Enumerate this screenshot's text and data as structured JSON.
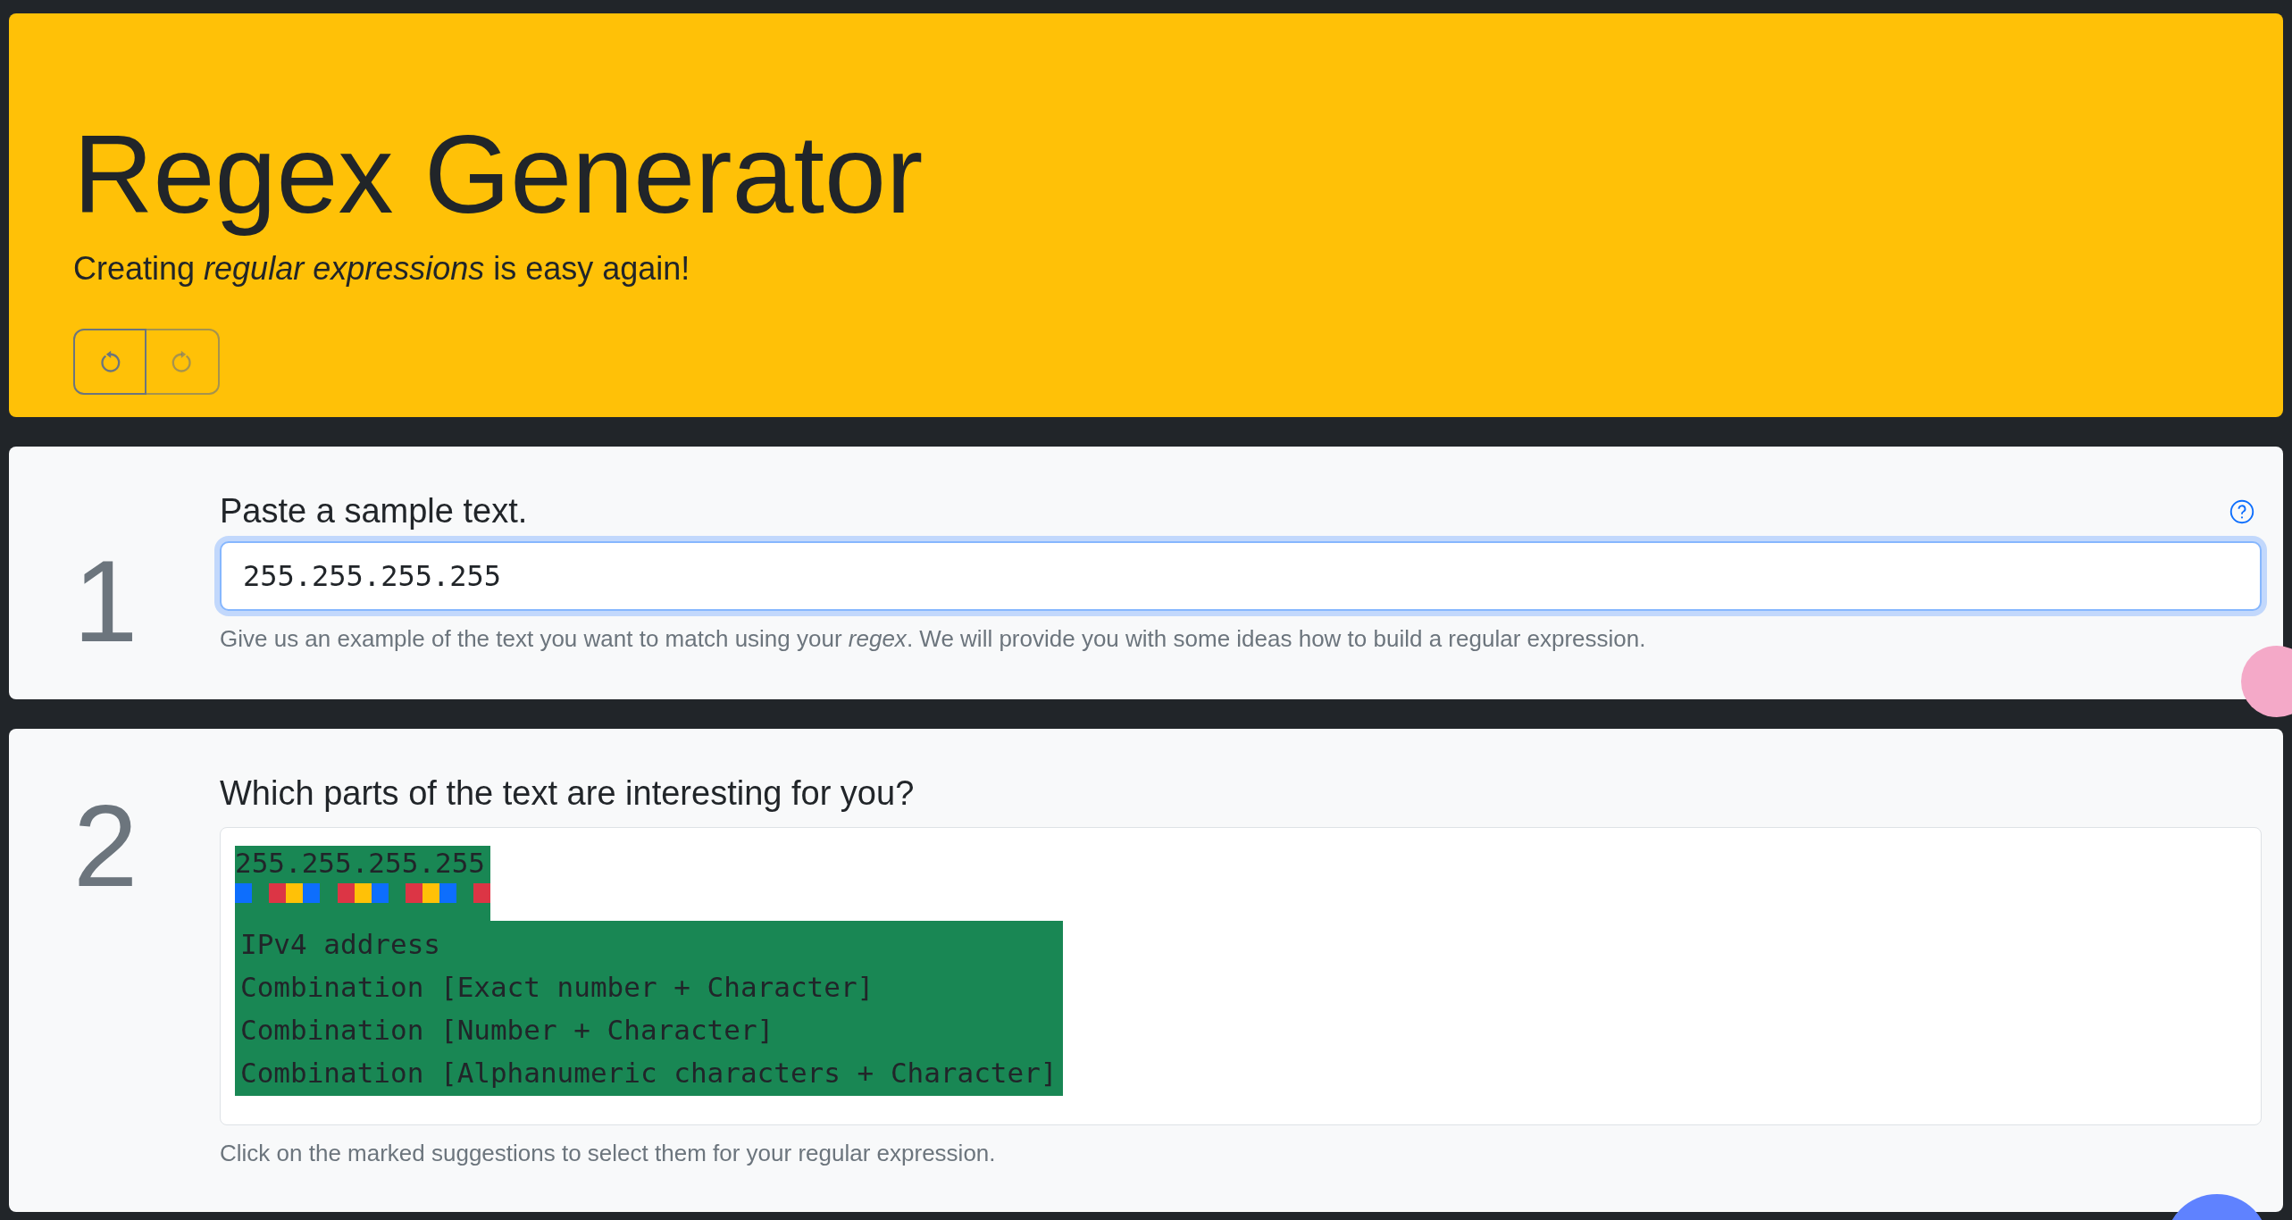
{
  "header": {
    "title": "Regex Generator",
    "subtitle": "Creating *regular expressions* is easy again!",
    "undo": {
      "disabled": false
    },
    "redo": {
      "disabled": true
    }
  },
  "steps": [
    {
      "number": "1",
      "heading": "Paste a sample text.",
      "help": true,
      "input": {
        "value": "255.255.255.255",
        "focused": true
      },
      "hint": "Give us an example of the text you want to match using your *regex*. We will provide you with some ideas how to build a regular expression."
    },
    {
      "number": "2",
      "heading": "Which parts of the text are interesting for you?",
      "sample": "255.255.255.255",
      "char_marks": [
        {
          "color": "#0d6efd"
        },
        {
          "color": "#198754"
        },
        {
          "color": "#dc3545"
        },
        {
          "color": "#ffc107"
        },
        {
          "color": "#0d6efd"
        },
        {
          "color": "#198754"
        },
        {
          "color": "#dc3545"
        },
        {
          "color": "#ffc107"
        },
        {
          "color": "#0d6efd"
        },
        {
          "color": "#198754"
        },
        {
          "color": "#dc3545"
        },
        {
          "color": "#ffc107"
        },
        {
          "color": "#0d6efd"
        },
        {
          "color": "#198754"
        },
        {
          "color": "#dc3545"
        }
      ],
      "suggestions": [
        "IPv4 address",
        "Combination [Exact number + Character]",
        "Combination [Number + Character]",
        "Combination [Alphanumeric characters + Character]"
      ],
      "hint": "Click on the marked suggestions to select them for your regular expression."
    }
  ]
}
